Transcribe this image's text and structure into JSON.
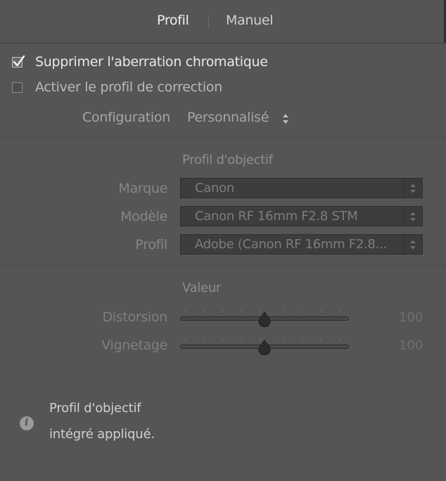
{
  "tabs": {
    "active": "Profil",
    "inactive": "Manuel"
  },
  "checkboxes": [
    {
      "label": "Supprimer l'aberration chromatique",
      "checked": true
    },
    {
      "label": "Activer le profil de correction",
      "checked": false
    }
  ],
  "configuration": {
    "label": "Configuration",
    "value": "Personnalisé"
  },
  "lens_profile": {
    "title": "Profil d'objectif",
    "make": {
      "label": "Marque",
      "value": "Canon"
    },
    "model": {
      "label": "Modèle",
      "value": "Canon RF 16mm F2.8 STM"
    },
    "profile": {
      "label": "Profil",
      "value": "Adobe (Canon RF 16mm F2.8..."
    }
  },
  "amount": {
    "title": "Valeur",
    "distortion": {
      "label": "Distorsion",
      "value": "100"
    },
    "vignetting": {
      "label": "Vignetage",
      "value": "100"
    }
  },
  "info": {
    "line1": "Profil d'objectif",
    "line2": "intégré appliqué."
  },
  "colors": {
    "background": "#555555",
    "select_bg": "#3d3d3d"
  },
  "icons": {
    "checkbox_check": "checkmark-icon",
    "select": "up-down-arrows-icon",
    "info": "info-icon",
    "slider_thumb": "slider-thumb-icon"
  }
}
